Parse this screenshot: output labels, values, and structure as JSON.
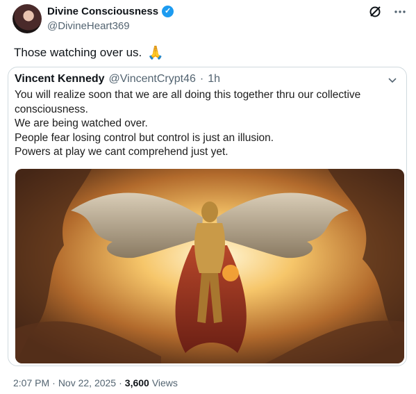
{
  "author": {
    "display_name": "Divine Consciousness",
    "handle": "@DivineHeart369",
    "verified_glyph": "✓"
  },
  "tweet": {
    "text": "Those watching over us.",
    "emoji": "🙏"
  },
  "quoted": {
    "display_name": "Vincent Kennedy",
    "handle": "@VincentCrypt46",
    "separator": "·",
    "time": "1h",
    "lines": [
      "You will realize soon that we are all doing this together thru our collective",
      "consciousness.",
      "We are being watched over.",
      "People fear losing control but control is just an illusion.",
      "Powers at play we cant comprehend just yet."
    ]
  },
  "meta": {
    "time": "2:07 PM",
    "sep1": "·",
    "date": "Nov 22, 2025",
    "sep2": "·",
    "views_count": "3,600",
    "views_label": "Views"
  },
  "icons": {
    "grok": "slash-circle-icon",
    "more": "more-horizontal-icon",
    "chevron": "chevron-down-icon"
  },
  "colors": {
    "verified": "#1d9bf0",
    "secondary_text": "#536471",
    "border": "#cfd9de"
  }
}
